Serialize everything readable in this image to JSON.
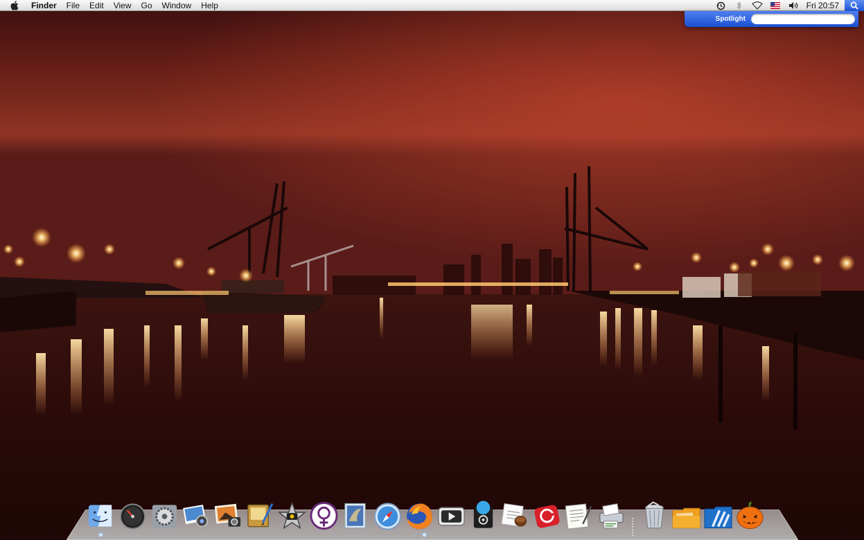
{
  "menubar": {
    "apple_icon": "apple-icon",
    "items": [
      "Finder",
      "File",
      "Edit",
      "View",
      "Go",
      "Window",
      "Help"
    ],
    "status_icons": [
      "time-machine-icon",
      "bluetooth-icon",
      "wifi-icon",
      "us-flag-input-icon",
      "volume-icon"
    ],
    "clock": "Fri 20:57",
    "spotlight_icon": "magnifier-icon"
  },
  "spotlight": {
    "label": "Spotlight",
    "value": "",
    "placeholder": ""
  },
  "dock": {
    "apps": [
      {
        "name": "finder",
        "icon": "finder-icon"
      },
      {
        "name": "dashboard",
        "icon": "dashboard-icon"
      },
      {
        "name": "system-preferences",
        "icon": "system-preferences-icon"
      },
      {
        "name": "image-capture",
        "icon": "image-capture-icon"
      },
      {
        "name": "iphoto",
        "icon": "iphoto-icon"
      },
      {
        "name": "iweb",
        "icon": "iweb-icon"
      },
      {
        "name": "imovie",
        "icon": "imovie-icon"
      },
      {
        "name": "adium",
        "icon": "adium-icon"
      },
      {
        "name": "mail",
        "icon": "mail-icon"
      },
      {
        "name": "safari",
        "icon": "safari-icon"
      },
      {
        "name": "firefox",
        "icon": "firefox-icon"
      },
      {
        "name": "front-row",
        "icon": "front-row-icon"
      },
      {
        "name": "itunes",
        "icon": "itunes-icon"
      },
      {
        "name": "coffee",
        "icon": "coffee-icon"
      },
      {
        "name": "red-app",
        "icon": "red-app-icon"
      },
      {
        "name": "textedit",
        "icon": "textedit-icon"
      },
      {
        "name": "printer",
        "icon": "printer-icon"
      }
    ],
    "right_items": [
      {
        "name": "trash",
        "icon": "trash-icon"
      },
      {
        "name": "documents-stack",
        "icon": "folder-stack-icon"
      },
      {
        "name": "applications-stack",
        "icon": "blue-folder-icon"
      },
      {
        "name": "halloween",
        "icon": "pumpkin-icon"
      }
    ]
  },
  "colors": {
    "sky_top": "#4a1414",
    "sky_glow": "#a83a28",
    "water": "#2a0a08",
    "light_orange": "#ffb25a",
    "spotlight_blue": "#2c5fe0"
  }
}
